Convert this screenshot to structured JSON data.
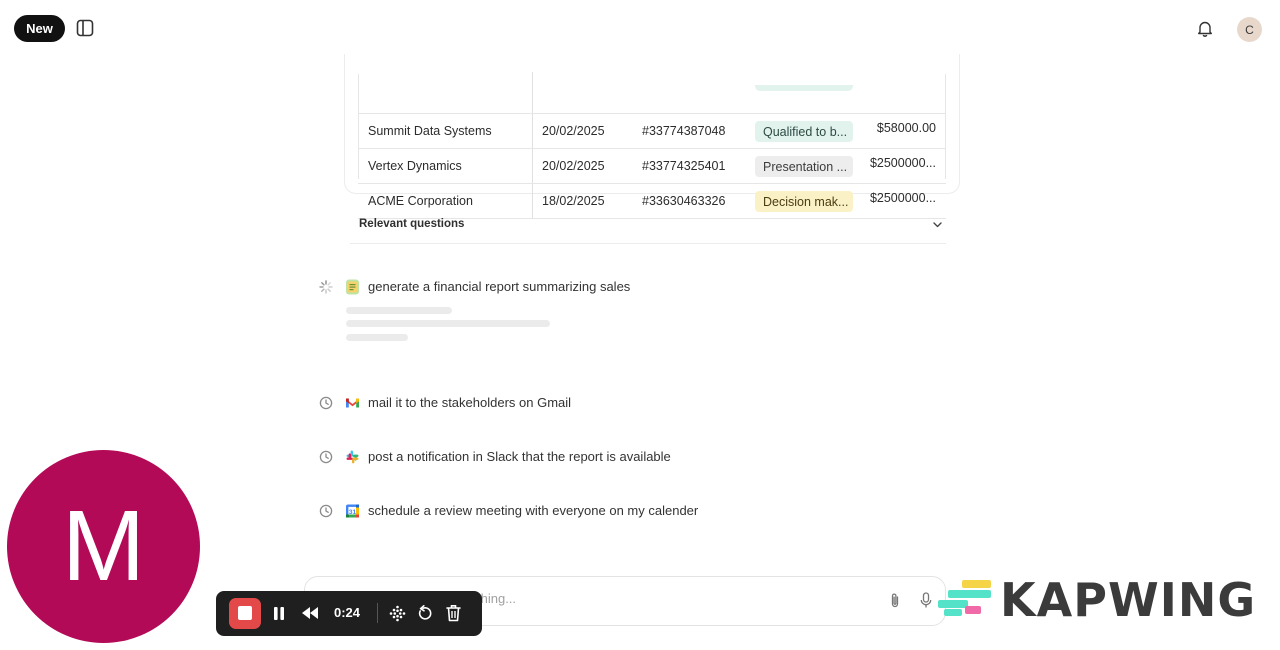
{
  "header": {
    "new_button": "New",
    "avatar_initial": "C"
  },
  "table": {
    "rows": [
      {
        "company": "Summit Data Systems",
        "date": "20/02/2025",
        "id": "#33774387048",
        "stage": "Qualified to b...",
        "stage_color": "green",
        "amount": "$58000.00"
      },
      {
        "company": "Vertex Dynamics",
        "date": "20/02/2025",
        "id": "#33774325401",
        "stage": "Presentation ...",
        "stage_color": "grey",
        "amount": "$2500000..."
      },
      {
        "company": "ACME Corporation",
        "date": "18/02/2025",
        "id": "#33630463326",
        "stage": "Decision mak...",
        "stage_color": "yellow",
        "amount": "$2500000..."
      }
    ]
  },
  "relevant_questions": {
    "label": "Relevant questions"
  },
  "steps": [
    {
      "text": "generate a financial report summarizing sales",
      "status": "loading-spinner-icon",
      "app": "report-app-icon"
    },
    {
      "text": "mail it to the stakeholders on Gmail",
      "status": "clock-icon",
      "app": "gmail-icon"
    },
    {
      "text": "post a notification in Slack that the report is available",
      "status": "clock-icon",
      "app": "slack-icon"
    },
    {
      "text": "schedule a review meeting with everyone on my calender",
      "status": "clock-icon",
      "app": "google-calendar-icon"
    }
  ],
  "composer": {
    "placeholder_fragment": "thing..."
  },
  "recorder": {
    "avatar_letter": "M",
    "elapsed": "0:24"
  },
  "watermark": {
    "brand": "KAPWING"
  },
  "colors": {
    "accent_dark": "#111111",
    "recorder_red": "#e44949",
    "avatar_magenta": "#b30a57"
  }
}
